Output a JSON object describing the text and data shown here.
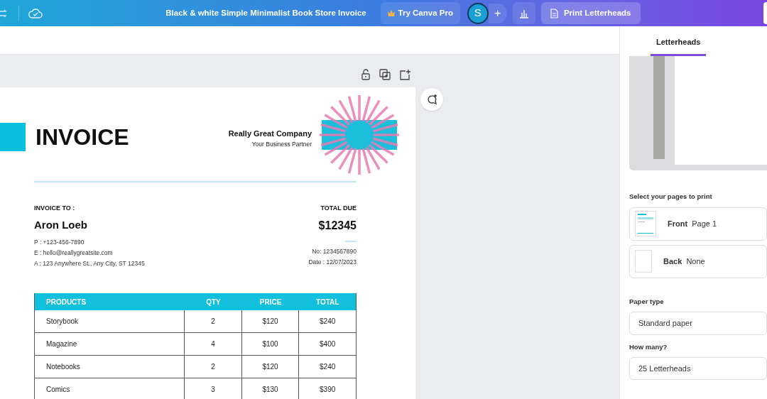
{
  "topbar": {
    "title": "Black & white Simple Minimalist Book Store Invoice",
    "pro_button": "Try Canva Pro",
    "avatar": "S",
    "plus": "+",
    "print_button": "Print Letterheads"
  },
  "invoice": {
    "title": "INVOICE",
    "company": "Really Great Company",
    "tagline": "Your Business Partner",
    "bill_to_label": "INVOICE TO :",
    "client": "Aron Loeb",
    "contact": [
      "P : +123-456-7890",
      "E : hello@reallygreatsite.com",
      "A : 123 Anywhere St., Any City, ST 12345"
    ],
    "total_label": "TOTAL DUE",
    "total": "$12345",
    "meta": [
      "No: 1234567890",
      "Date : 12/07/2023"
    ],
    "table": {
      "columns": [
        "PRODUCTS",
        "QTY",
        "PRICE",
        "TOTAL"
      ],
      "rows": [
        [
          "Storybook",
          "2",
          "$120",
          "$240"
        ],
        [
          "Magazine",
          "4",
          "$100",
          "$400"
        ],
        [
          "Notebooks",
          "2",
          "$120",
          "$240"
        ],
        [
          "Comics",
          "3",
          "$130",
          "$390"
        ]
      ]
    }
  },
  "panel": {
    "tabs": [
      {
        "label": "Letterheads",
        "selected": true
      }
    ],
    "pages_label": "Select your pages to print",
    "pages": [
      {
        "side": "Front",
        "value": "Page 1",
        "kind": "thumb"
      },
      {
        "side": "Back",
        "value": "None",
        "kind": "blank"
      }
    ],
    "paper_label": "Paper type",
    "paper_value": "Standard paper",
    "count_label": "How many?",
    "count_value": "25 Letterheads"
  }
}
